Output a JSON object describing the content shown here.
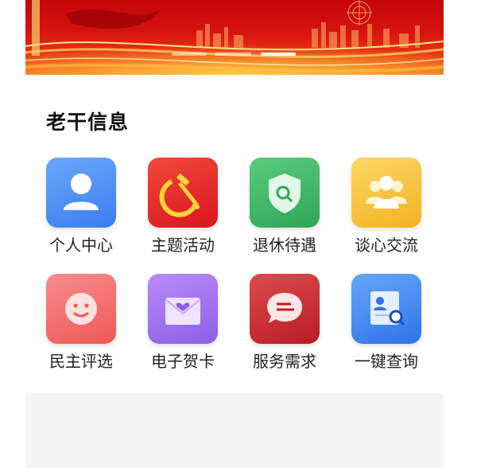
{
  "section": {
    "title": "老干信息"
  },
  "menu": [
    {
      "label": "个人中心",
      "icon": "user-icon",
      "color": "#3f86f4"
    },
    {
      "label": "主题活动",
      "icon": "hammer-sickle-icon",
      "color": "#e8262a"
    },
    {
      "label": "退休待遇",
      "icon": "shield-search-icon",
      "color": "#37b363"
    },
    {
      "label": "谈心交流",
      "icon": "group-icon",
      "color": "#f7c23c"
    },
    {
      "label": "民主评选",
      "icon": "smiley-icon",
      "color": "#f56d6d"
    },
    {
      "label": "电子贺卡",
      "icon": "envelope-heart-icon",
      "color": "#a56ef0"
    },
    {
      "label": "服务需求",
      "icon": "chat-bubble-icon",
      "color": "#cf3034"
    },
    {
      "label": "一键查询",
      "icon": "profile-search-icon",
      "color": "#3a86f1"
    }
  ],
  "banner": {
    "slide_count": 3,
    "active_slide": 3
  }
}
